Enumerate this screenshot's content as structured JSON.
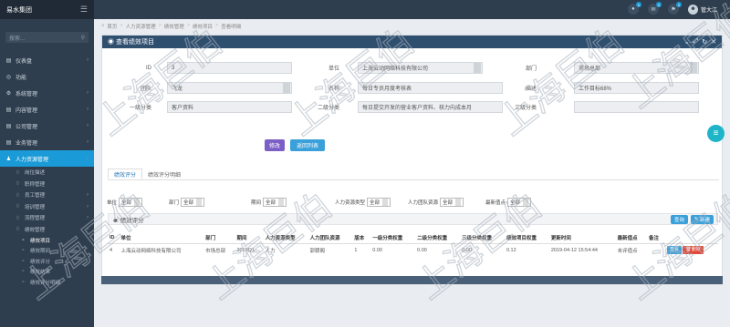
{
  "brand": {
    "name": "易水集团"
  },
  "search": {
    "placeholder": "搜索..."
  },
  "nav": [
    {
      "label": "仪表盘",
      "icon": "▤",
      "type": "top",
      "chev": true
    },
    {
      "label": "功能",
      "icon": "◎",
      "type": "top",
      "chev": false
    },
    {
      "label": "系统管理",
      "icon": "⚙",
      "type": "top",
      "chev": true
    },
    {
      "label": "内容管理",
      "icon": "▤",
      "type": "top",
      "chev": true
    },
    {
      "label": "公司管理",
      "icon": "▤",
      "type": "top",
      "chev": true
    },
    {
      "label": "业务管理",
      "icon": "▤",
      "type": "top",
      "chev": true
    },
    {
      "label": "人力资源管理",
      "icon": "♟",
      "type": "active",
      "chev": true
    },
    {
      "label": "岗位描述",
      "icon": "♢",
      "type": "sub",
      "chev": false
    },
    {
      "label": "职称管理",
      "icon": "♢",
      "type": "sub",
      "chev": false
    },
    {
      "label": "员工管理",
      "icon": "♢",
      "type": "sub",
      "chev": true
    },
    {
      "label": "培训管理",
      "icon": "♢",
      "type": "sub",
      "chev": true
    },
    {
      "label": "流程管理",
      "icon": "♢",
      "type": "sub",
      "chev": true
    },
    {
      "label": "绩效管理",
      "icon": "♢",
      "type": "sub",
      "chev": true
    },
    {
      "label": "绩效项目",
      "icon": "▫",
      "type": "sub2on",
      "chev": false
    },
    {
      "label": "绩效期间",
      "icon": "▫",
      "type": "sub2",
      "chev": false
    },
    {
      "label": "绩效评分",
      "icon": "▫",
      "type": "sub2",
      "chev": false
    },
    {
      "label": "绩效结果",
      "icon": "▫",
      "type": "sub2",
      "chev": false
    },
    {
      "label": "绩效评分明细",
      "icon": "▫",
      "type": "sub2",
      "chev": false
    }
  ],
  "header": {
    "badges": [
      "0",
      "0",
      "0"
    ],
    "user": "管大江"
  },
  "breadcrumb": [
    "首页",
    "人力资源管理",
    "绩效管理",
    "绩效项目",
    "查看明细"
  ],
  "panel": {
    "title": "查看绩效项目",
    "fields": {
      "id": {
        "label": "ID",
        "value": "3"
      },
      "unit": {
        "label": "单位",
        "value": "上海云动网络科技有限公司"
      },
      "dept": {
        "label": "部门",
        "value": "市场总部"
      },
      "team": {
        "label": "团队",
        "value": "飞龙"
      },
      "name": {
        "label": "名称",
        "value": "每日专员月度考核表"
      },
      "desc": {
        "label": "描述",
        "value": "工作目标68%"
      },
      "cat1": {
        "label": "一级分类",
        "value": "客户资料"
      },
      "cat2": {
        "label": "二级分类",
        "value": "每日提交开发的营业客户资料、核力向成本月"
      },
      "cat3": {
        "label": "三级分类",
        "value": ""
      }
    },
    "buttons": {
      "edit": "修改",
      "back": "返回列表"
    },
    "tabs": [
      "绩效评分",
      "绩效评分明细"
    ],
    "filters": [
      {
        "label": "单位",
        "value": "全部"
      },
      {
        "label": "部门",
        "value": "全部"
      },
      {
        "label": "期间",
        "value": "全部"
      },
      {
        "label": "人力资源类型",
        "value": "全部"
      },
      {
        "label": "人力团队资源",
        "value": "全部"
      },
      {
        "label": "最新值点",
        "value": "全部"
      }
    ],
    "section": {
      "title": "绩效评分",
      "query": "查询",
      "create": "新建"
    },
    "table": {
      "headers": [
        "ID",
        "单位",
        "部门",
        "期间",
        "人力资源类型",
        "人力团队资源",
        "版本",
        "一级分类权重",
        "二级分类权重",
        "三级分类权重",
        "绩效项目权重",
        "更新时间",
        "最新值点",
        "备注",
        ""
      ],
      "rows": [
        [
          "4",
          "上海云动网络科技有限公司",
          "市场总部",
          "2019Q1",
          "人力",
          "郭朝阁",
          "1",
          "0.00",
          "0.00",
          "0.00",
          "0.12",
          "2019-04-12 15:54:44",
          "未评值点",
          "",
          ""
        ]
      ],
      "actions": {
        "view": "查看",
        "delete": "删除"
      }
    }
  },
  "colors": {
    "accent": "#1a9ad6",
    "edit": "#7b5fc6",
    "back": "#3aa0da",
    "delete": "#e04a3a",
    "sidebar": "#2f3e4e"
  },
  "watermark": "上海巨伯"
}
